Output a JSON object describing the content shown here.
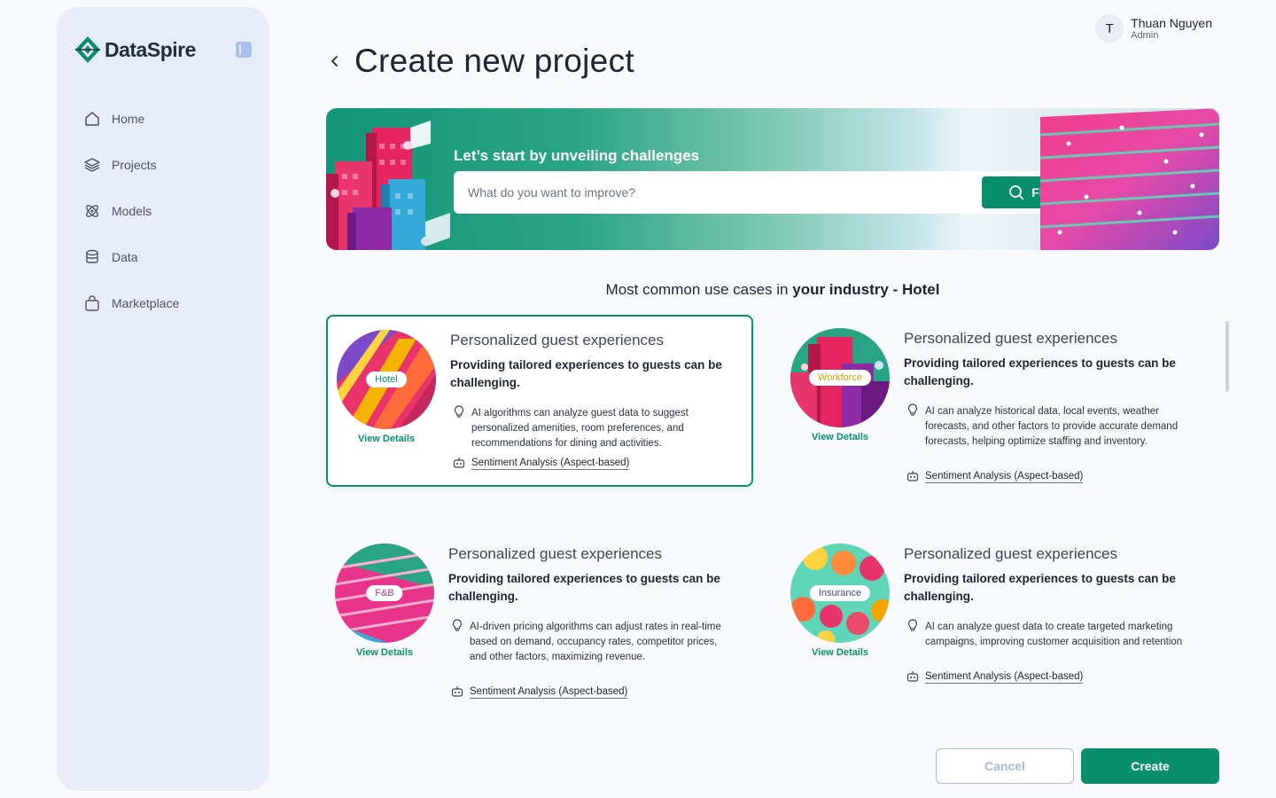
{
  "brand": {
    "name": "DataSpire"
  },
  "sidebar": {
    "items": [
      {
        "label": "Home",
        "icon": "home-icon"
      },
      {
        "label": "Projects",
        "icon": "layers-icon"
      },
      {
        "label": "Models",
        "icon": "atom-icon"
      },
      {
        "label": "Data",
        "icon": "database-icon"
      },
      {
        "label": "Marketplace",
        "icon": "shopping-bag-icon"
      }
    ]
  },
  "user": {
    "initial": "T",
    "name": "Thuan Nguyen",
    "role": "Admin"
  },
  "header": {
    "title": "Create new project"
  },
  "banner": {
    "title": "Let’s start by unveiling challenges",
    "search_placeholder": "What do you want to improve?",
    "find_label": "Find"
  },
  "section": {
    "title_prefix": "Most common use cases in ",
    "title_bold": "your industry - Hotel"
  },
  "cards": [
    {
      "tag": "Hotel",
      "view_details": "View Details",
      "title": "Personalized guest experiences",
      "subtitle": "Providing tailored experiences to guests can be challenging.",
      "description": "AI algorithms can analyze guest data to suggest personalized amenities, room preferences, and recommendations for dining and activities.",
      "link": "Sentiment Analysis (Aspect-based)"
    },
    {
      "tag": "Workforce",
      "view_details": "View Details",
      "title": "Personalized guest experiences",
      "subtitle": "Providing tailored experiences to guests can be challenging.",
      "description": "AI can analyze historical data, local events, weather forecasts, and other factors to provide accurate demand forecasts, helping optimize staffing and inventory.",
      "link": "Sentiment Analysis (Aspect-based)"
    },
    {
      "tag": "F&B",
      "view_details": "View Details",
      "title": "Personalized guest experiences",
      "subtitle": "Providing tailored experiences to guests can be challenging.",
      "description": "AI-driven pricing algorithms can adjust rates in real-time based on demand, occupancy rates, competitor prices, and other factors, maximizing revenue.",
      "link": "Sentiment Analysis (Aspect-based)"
    },
    {
      "tag": "Insurance",
      "view_details": "View Details",
      "title": "Personalized guest experiences",
      "subtitle": "Providing tailored experiences to guests can be challenging.",
      "description": "AI can analyze guest data to create targeted marketing campaigns, improving customer acquisition and retention",
      "link": "Sentiment Analysis (Aspect-based)"
    }
  ],
  "actions": {
    "cancel": "Cancel",
    "create": "Create"
  },
  "colors": {
    "accent": "#0a8f6c",
    "sidebar_bg": "#e6edf9"
  }
}
